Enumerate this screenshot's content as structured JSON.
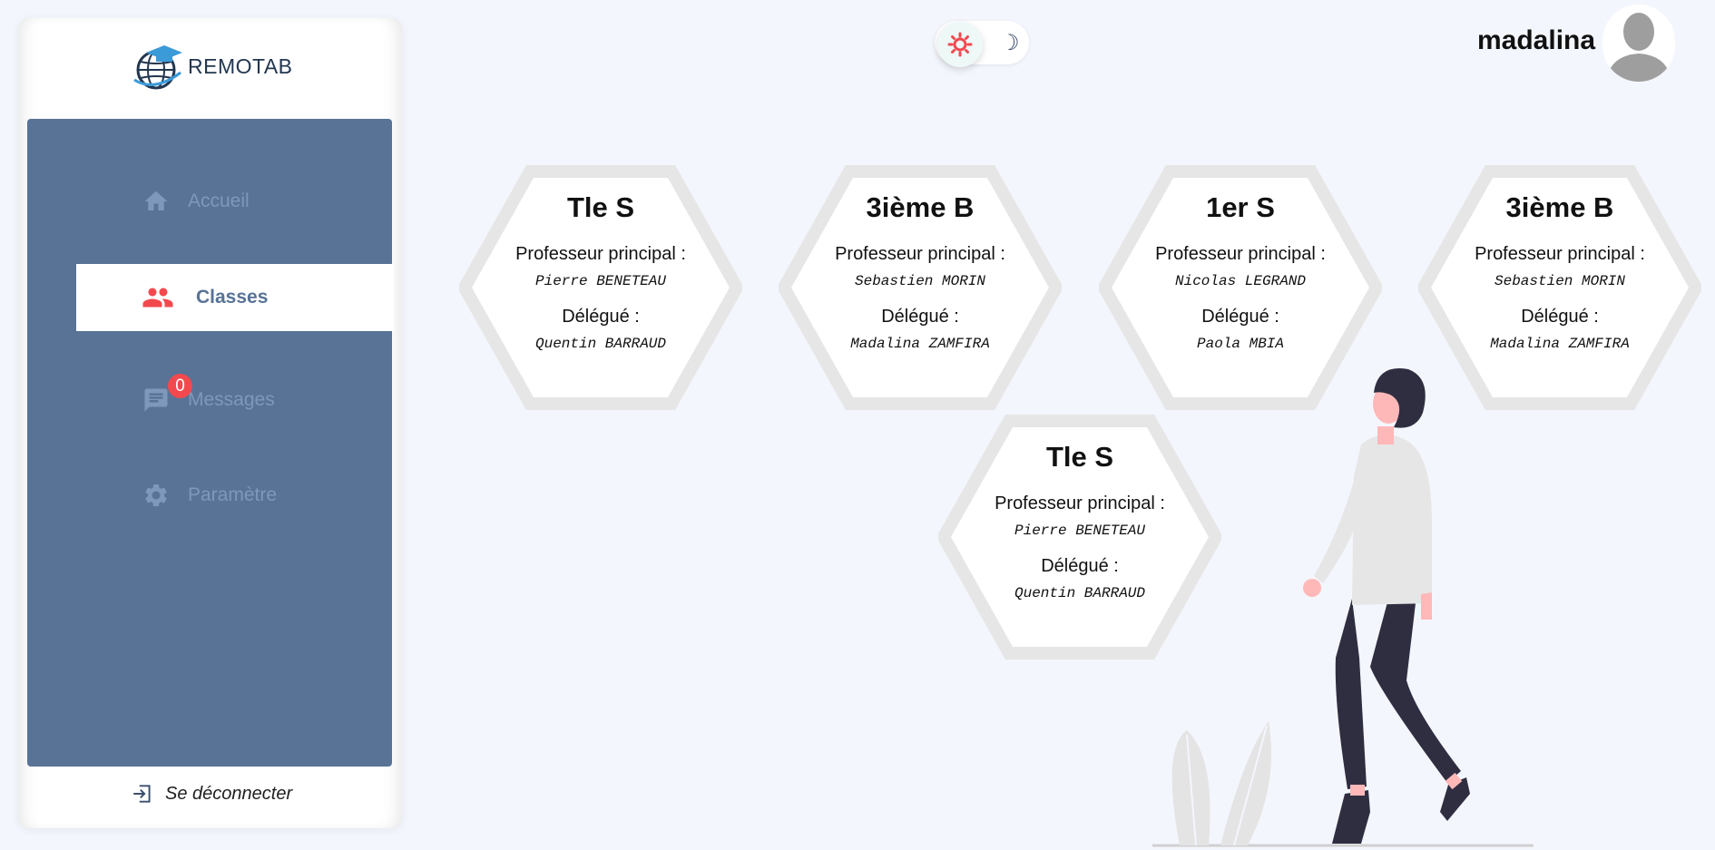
{
  "app": {
    "name": "REMOTAB"
  },
  "sidebar": {
    "items": [
      {
        "label": "Accueil",
        "icon": "home-icon"
      },
      {
        "label": "Classes",
        "icon": "users-icon",
        "active": true
      },
      {
        "label": "Messages",
        "icon": "message-icon",
        "badge": "0"
      },
      {
        "label": "Paramètre",
        "icon": "gear-icon"
      }
    ],
    "logout_label": "Se déconnecter"
  },
  "header": {
    "theme_toggle": {
      "mode": "light",
      "sun_icon": "sun-icon",
      "moon_icon": "moon-icon"
    },
    "username": "madalina"
  },
  "classes": [
    {
      "name": "Tle S",
      "prof_label": "Professeur principal :",
      "prof": "Pierre BENETEAU",
      "delegate_label": "Délégué :",
      "delegate": "Quentin BARRAUD"
    },
    {
      "name": "3ième B",
      "prof_label": "Professeur principal :",
      "prof": "Sebastien MORIN",
      "delegate_label": "Délégué :",
      "delegate": "Madalina ZAMFIRA"
    },
    {
      "name": "1er S",
      "prof_label": "Professeur principal :",
      "prof": "Nicolas LEGRAND",
      "delegate_label": "Délégué :",
      "delegate": "Paola MBIA"
    },
    {
      "name": "3ième B",
      "prof_label": "Professeur principal :",
      "prof": "Sebastien MORIN",
      "delegate_label": "Délégué :",
      "delegate": "Madalina ZAMFIRA"
    },
    {
      "name": "Tle S",
      "prof_label": "Professeur principal :",
      "prof": "Pierre BENETEAU",
      "delegate_label": "Délégué :",
      "delegate": "Quentin BARRAUD"
    }
  ],
  "colors": {
    "sidebar_panel": "#587396",
    "accent_red": "#f2494f",
    "hex_border": "#e6e6e6",
    "background": "#f4f6fd"
  }
}
